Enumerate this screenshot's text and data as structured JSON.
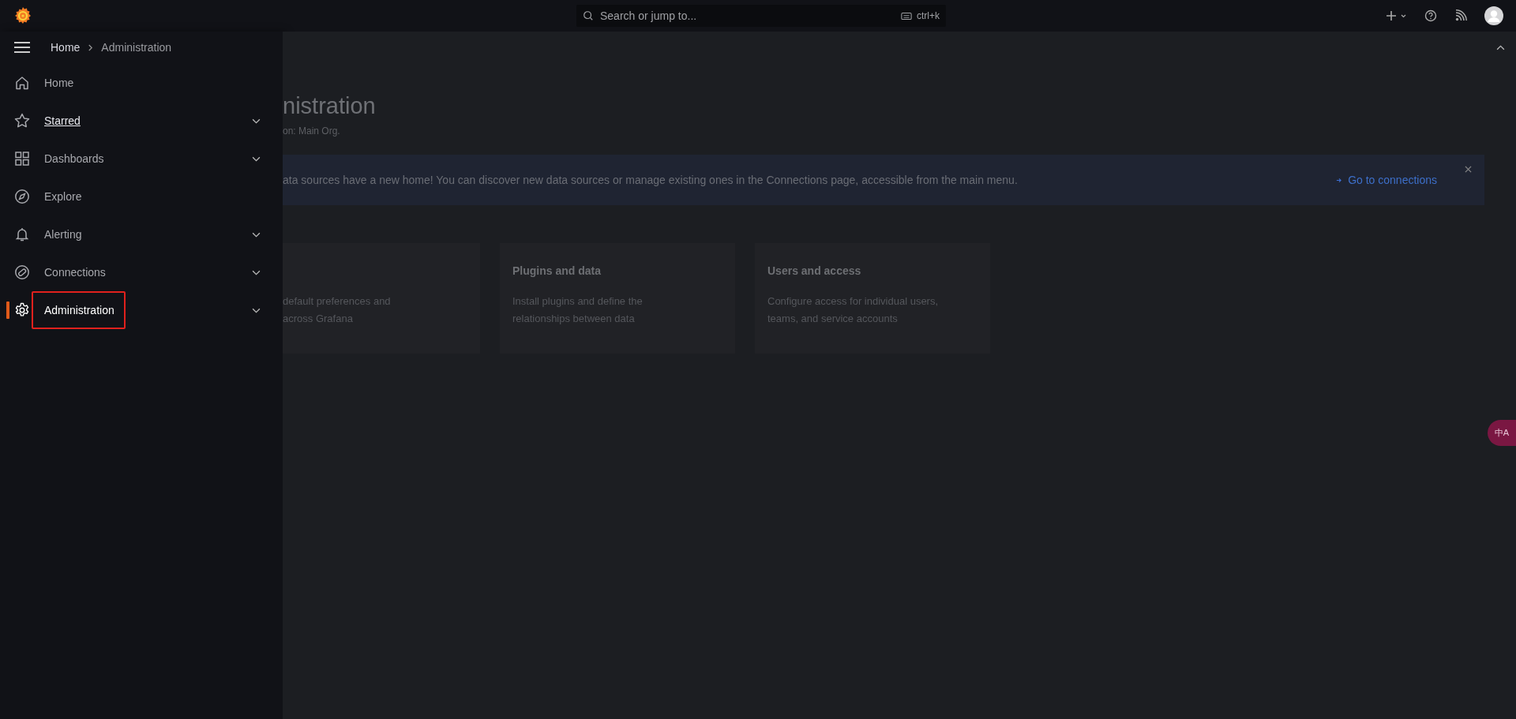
{
  "search": {
    "placeholder": "Search or jump to...",
    "shortcut": "ctrl+k"
  },
  "breadcrumbs": [
    {
      "label": "Home",
      "current": false
    },
    {
      "label": "Administration",
      "current": true
    }
  ],
  "nav_items": [
    {
      "label": "Home",
      "selected": false,
      "expandable": false,
      "focused": false,
      "highlighted": false
    },
    {
      "label": "Starred",
      "selected": false,
      "expandable": true,
      "focused": true,
      "highlighted": false
    },
    {
      "label": "Dashboards",
      "selected": false,
      "expandable": true,
      "focused": false,
      "highlighted": false
    },
    {
      "label": "Explore",
      "selected": false,
      "expandable": false,
      "focused": false,
      "highlighted": false
    },
    {
      "label": "Alerting",
      "selected": false,
      "expandable": true,
      "focused": false,
      "highlighted": false
    },
    {
      "label": "Connections",
      "selected": false,
      "expandable": true,
      "focused": false,
      "highlighted": false
    },
    {
      "label": "Administration",
      "selected": true,
      "expandable": true,
      "focused": false,
      "highlighted": true
    }
  ],
  "page": {
    "title": "nistration",
    "subtitle": "on: Main Org."
  },
  "banner": {
    "text": "ata sources have a new home! You can discover new data sources or manage existing ones in the Connections page, accessible from the main menu.",
    "link": "Go to connections"
  },
  "cards": [
    {
      "description": [
        "default preferences and",
        "across Grafana"
      ]
    },
    {
      "title": "Plugins and data",
      "description": [
        "Install plugins and define the",
        "relationships between data"
      ]
    },
    {
      "title": "Users and access",
      "description": [
        "Configure access for individual users,",
        "teams, and service accounts"
      ]
    }
  ],
  "translate_badge": "中A"
}
